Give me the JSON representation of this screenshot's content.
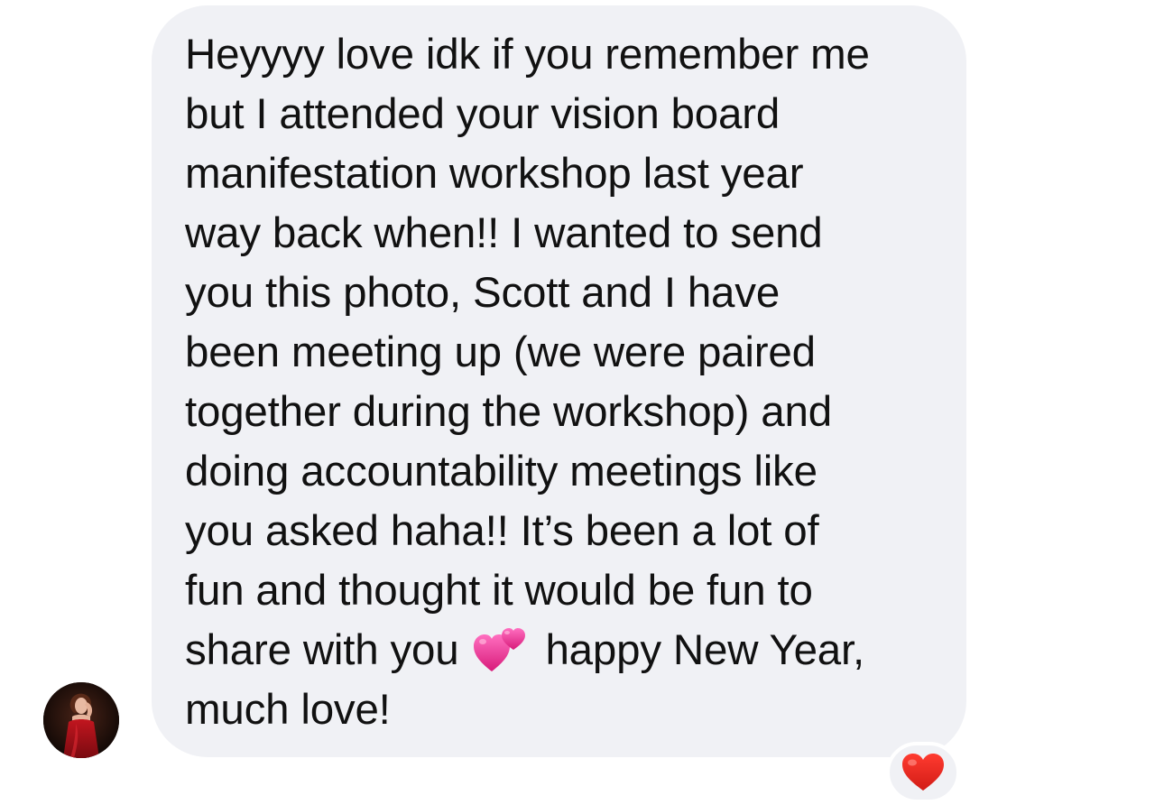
{
  "message": {
    "lines": [
      "Heyyyy love idk if you remember me",
      "but I attended your vision board",
      "manifestation workshop last year",
      "way back when!! I wanted to send",
      "you this photo, Scott and I have",
      "been meeting up (we were paired",
      "together during the workshop) and",
      "doing accountability meetings like",
      "you asked haha!! It’s been a lot of",
      "fun and thought it would be fun to"
    ],
    "emoji_line": {
      "before": "share with you",
      "emoji": "two-hearts-icon",
      "after": "happy New Year,"
    },
    "last_line": "much love!"
  },
  "sender": {
    "avatar": "profile-photo"
  },
  "reaction": {
    "emoji": "red-heart-icon"
  },
  "colors": {
    "bubble_bg": "#f0f1f5",
    "text": "#111111",
    "reaction_heart": "#e0201b",
    "emoji_pink": "#e8348e"
  }
}
